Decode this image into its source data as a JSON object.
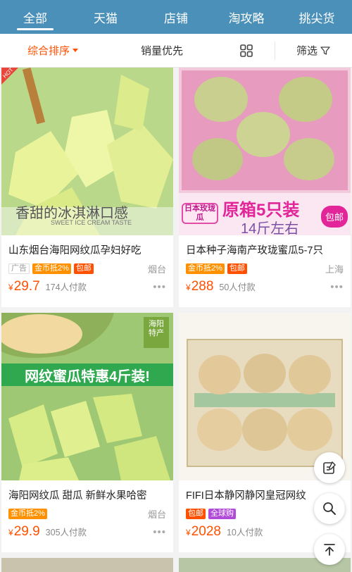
{
  "tabs": [
    "全部",
    "天猫",
    "店铺",
    "淘攻略",
    "挑尖货"
  ],
  "sort": {
    "default_label": "综合排序",
    "sales_label": "销量优先",
    "filter_label": "筛选"
  },
  "products": [
    {
      "title": "山东烟台海阳网纹瓜孕妇好吃",
      "tags": [
        "广告",
        "金币抵2%",
        "包邮"
      ],
      "location": "烟台",
      "price": "29.7",
      "sold": "174人付款",
      "image_corner": "HOT",
      "image_caption": "香甜的冰淇淋口感",
      "image_caption_en": "SWEET ICE CREAM TASTE"
    },
    {
      "title": "日本种子海南产玫珑蜜瓜5-7只",
      "tags": [
        "金币抵2%",
        "包邮"
      ],
      "location": "上海",
      "price": "288",
      "sold": "50人付款",
      "image_badge": "日本玫珑瓜",
      "image_headline": "原箱5只装",
      "image_sub": "14斤左右",
      "image_tag": "包邮"
    },
    {
      "title": "海阳网纹瓜 甜瓜 新鲜水果哈密",
      "tags": [
        "金币抵2%"
      ],
      "location": "烟台",
      "price": "29.9",
      "sold": "305人付款",
      "image_banner": "网纹蜜瓜特惠4斤装!",
      "image_stamp": "海阳特产"
    },
    {
      "title": "FIFI日本静冈静冈皇冠网纹",
      "tags": [
        "包邮",
        "全球购"
      ],
      "location": "",
      "price": "2028",
      "sold": "10人付款"
    }
  ],
  "currency": "¥",
  "more": "•••",
  "icons": [
    "edit-icon",
    "search-icon",
    "back-to-top-icon"
  ],
  "colors": {
    "brand": "#4a90b8",
    "accent": "#ff5000"
  }
}
